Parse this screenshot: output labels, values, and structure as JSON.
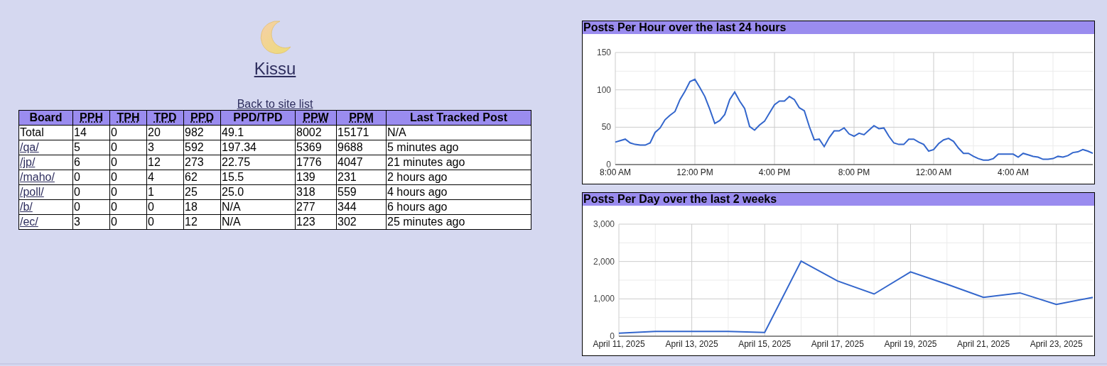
{
  "site": {
    "title": "Kissu",
    "back_link": "Back to site list"
  },
  "table": {
    "columns": [
      {
        "label": "Board",
        "abbr": false
      },
      {
        "label": "PPH",
        "abbr": true
      },
      {
        "label": "TPH",
        "abbr": true
      },
      {
        "label": "TPD",
        "abbr": true
      },
      {
        "label": "PPD",
        "abbr": true
      },
      {
        "label": "PPD/TPD",
        "abbr": false
      },
      {
        "label": "PPW",
        "abbr": true
      },
      {
        "label": "PPM",
        "abbr": true
      },
      {
        "label": "Last Tracked Post",
        "abbr": false
      }
    ],
    "rows": [
      {
        "link": false,
        "cells": [
          "Total",
          "14",
          "0",
          "20",
          "982",
          "49.1",
          "8002",
          "15171",
          "N/A"
        ]
      },
      {
        "link": true,
        "cells": [
          "/qa/",
          "5",
          "0",
          "3",
          "592",
          "197.34",
          "5369",
          "9688",
          "5 minutes ago"
        ]
      },
      {
        "link": true,
        "cells": [
          "/jp/",
          "6",
          "0",
          "12",
          "273",
          "22.75",
          "1776",
          "4047",
          "21 minutes ago"
        ]
      },
      {
        "link": true,
        "cells": [
          "/maho/",
          "0",
          "0",
          "4",
          "62",
          "15.5",
          "139",
          "231",
          "2 hours ago"
        ]
      },
      {
        "link": true,
        "cells": [
          "/poll/",
          "0",
          "0",
          "1",
          "25",
          "25.0",
          "318",
          "559",
          "4 hours ago"
        ]
      },
      {
        "link": true,
        "cells": [
          "/b/",
          "0",
          "0",
          "0",
          "18",
          "N/A",
          "277",
          "344",
          "6 hours ago"
        ]
      },
      {
        "link": true,
        "cells": [
          "/ec/",
          "3",
          "0",
          "0",
          "12",
          "N/A",
          "123",
          "302",
          "25 minutes ago"
        ]
      }
    ]
  },
  "charts": [
    {
      "chart_data": {
        "type": "line",
        "title": "Posts Per Hour over the last 24 hours",
        "grid": true,
        "ylim": [
          0,
          150
        ],
        "yticks": [
          0,
          50,
          100,
          150
        ],
        "categories": [
          "8:00 AM",
          null,
          null,
          null,
          null,
          null,
          null,
          null,
          null,
          null,
          null,
          null,
          null,
          null,
          null,
          null,
          "12:00 PM",
          null,
          null,
          null,
          null,
          null,
          null,
          null,
          null,
          null,
          null,
          null,
          null,
          null,
          null,
          null,
          "4:00 PM",
          null,
          null,
          null,
          null,
          null,
          null,
          null,
          null,
          null,
          null,
          null,
          null,
          null,
          null,
          null,
          "8:00 PM",
          null,
          null,
          null,
          null,
          null,
          null,
          null,
          null,
          null,
          null,
          null,
          null,
          null,
          null,
          null,
          "12:00 AM",
          null,
          null,
          null,
          null,
          null,
          null,
          null,
          null,
          null,
          null,
          null,
          null,
          null,
          null,
          null,
          "4:00 AM",
          null,
          null,
          null,
          null,
          null,
          null,
          null,
          null,
          null,
          null,
          null,
          null,
          null,
          null,
          null,
          null
        ],
        "series": [
          {
            "color": "#3366cc",
            "values": [
              30,
              32,
              34,
              29,
              27,
              26,
              26,
              29,
              43,
              49,
              60,
              66,
              71,
              87,
              98,
              111,
              114,
              103,
              91,
              74,
              55,
              59,
              67,
              87,
              97,
              85,
              75,
              51,
              46,
              53,
              58,
              69,
              80,
              85,
              85,
              91,
              87,
              76,
              72,
              51,
              33,
              34,
              24,
              36,
              45,
              45,
              49,
              41,
              38,
              42,
              40,
              46,
              52,
              48,
              49,
              38,
              29,
              27,
              27,
              34,
              34,
              30,
              27,
              18,
              20,
              28,
              33,
              35,
              31,
              22,
              15,
              15,
              11,
              8,
              6,
              6,
              8,
              14,
              14,
              14,
              14,
              10,
              15,
              13,
              11,
              10,
              7,
              7,
              8,
              11,
              10,
              12,
              16,
              17,
              20,
              18,
              15
            ]
          }
        ]
      }
    },
    {
      "chart_data": {
        "type": "line",
        "title": "Posts Per Day over the last 2 weeks",
        "grid": true,
        "ylim": [
          0,
          3000
        ],
        "yticks": [
          {
            "value": 0,
            "label": "0"
          },
          {
            "value": 1000,
            "label": "1,000"
          },
          {
            "value": 2000,
            "label": "2,000"
          },
          {
            "value": 3000,
            "label": "3,000"
          }
        ],
        "categories": [
          "April 11, 2025",
          null,
          "April 13, 2025",
          null,
          "April 15, 2025",
          null,
          "April 17, 2025",
          null,
          "April 19, 2025",
          null,
          "April 21, 2025",
          null,
          "April 23, 2025",
          null
        ],
        "series": [
          {
            "color": "#3366cc",
            "values": [
              80,
              130,
              130,
              130,
              100,
              2010,
              1480,
              1130,
              1720,
              1390,
              1040,
              1160,
              850,
              1040
            ]
          }
        ]
      }
    }
  ]
}
